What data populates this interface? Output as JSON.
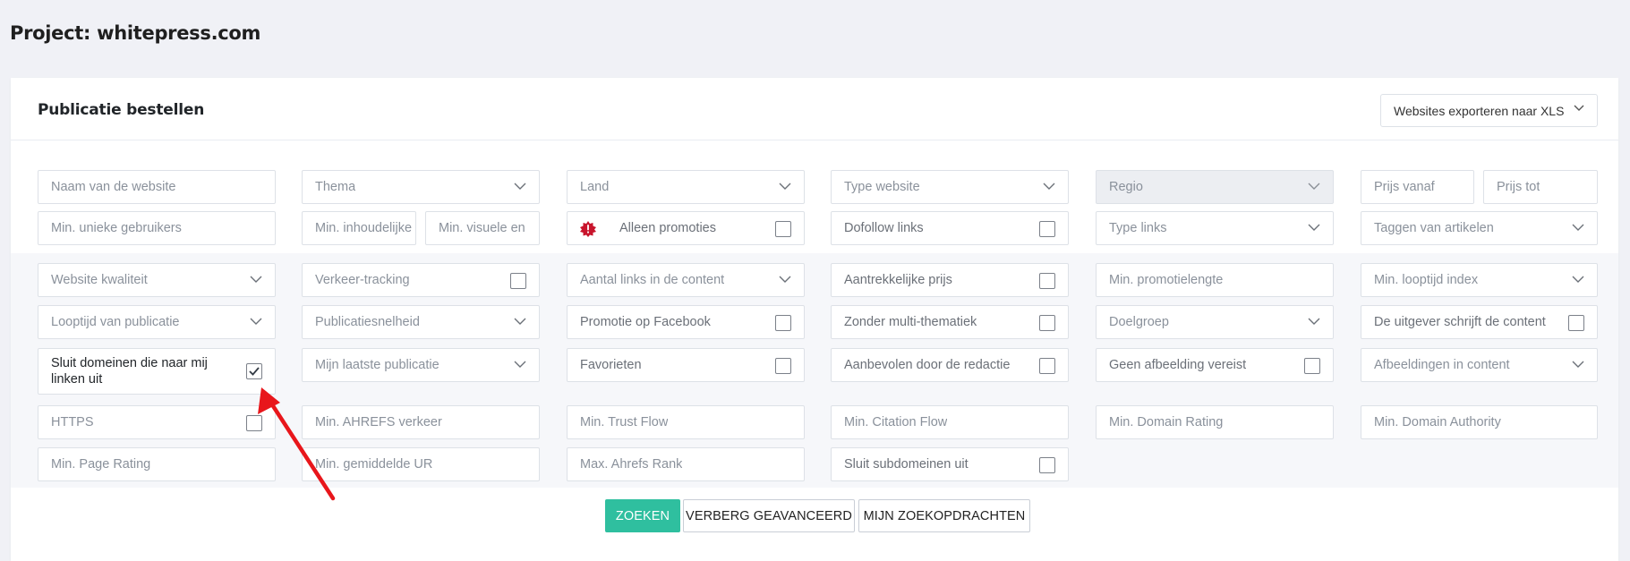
{
  "page": {
    "title": "Project: whitepress.com"
  },
  "card": {
    "title": "Publicatie bestellen",
    "export_label": "Websites exporteren naar XLS"
  },
  "filters": {
    "row1": {
      "website_name": "Naam van de website",
      "theme": "Thema",
      "country": "Land",
      "website_type": "Type website",
      "region": "Regio",
      "price_from": "Prijs vanaf",
      "price_to": "Prijs tot"
    },
    "row2": {
      "min_unique_users": "Min. unieke gebruikers",
      "min_content": "Min. inhoudelijke",
      "min_visual": "Min. visuele en",
      "only_promotions": "Alleen promoties",
      "dofollow": "Dofollow links",
      "link_type": "Type links",
      "tag_articles": "Taggen van artikelen"
    },
    "row3": {
      "website_quality": "Website kwaliteit",
      "traffic_tracking": "Verkeer-tracking",
      "links_in_content": "Aantal links in de content",
      "attractive_price": "Aantrekkelijke prijs",
      "min_promo_length": "Min. promotielengte",
      "min_duration_index": "Min. looptijd index"
    },
    "row4": {
      "publication_duration": "Looptijd van publicatie",
      "publication_speed": "Publicatiesnelheid",
      "facebook_promo": "Promotie op Facebook",
      "no_multi_theme": "Zonder multi-thematiek",
      "target_group": "Doelgroep",
      "publisher_writes": "De uitgever schrijft de content"
    },
    "row5": {
      "exclude_linking_domains": "Sluit domeinen die naar mij linken uit",
      "my_last_publication": "Mijn laatste publicatie",
      "favorites": "Favorieten",
      "recommended": "Aanbevolen door de redactie",
      "no_image_required": "Geen afbeelding vereist",
      "images_in_content": "Afbeeldingen in content"
    },
    "row6": {
      "https": "HTTPS",
      "min_ahrefs_traffic": "Min. AHREFS verkeer",
      "min_trust_flow": "Min. Trust Flow",
      "min_citation_flow": "Min. Citation Flow",
      "min_domain_rating": "Min. Domain Rating",
      "min_domain_authority": "Min. Domain Authority"
    },
    "row7": {
      "min_page_rating": "Min. Page Rating",
      "min_avg_ur": "Min. gemiddelde UR",
      "max_ahrefs_rank": "Max. Ahrefs Rank",
      "exclude_subdomains": "Sluit subdomeinen uit"
    }
  },
  "actions": {
    "search": "ZOEKEN",
    "hide_advanced": "VERBERG GEAVANCEERD",
    "my_searches": "MIJN ZOEKOPDRACHTEN"
  },
  "colors": {
    "primary": "#2fbf9f",
    "annotation_arrow": "#e8161b",
    "promo_icon": "#c8142c"
  }
}
